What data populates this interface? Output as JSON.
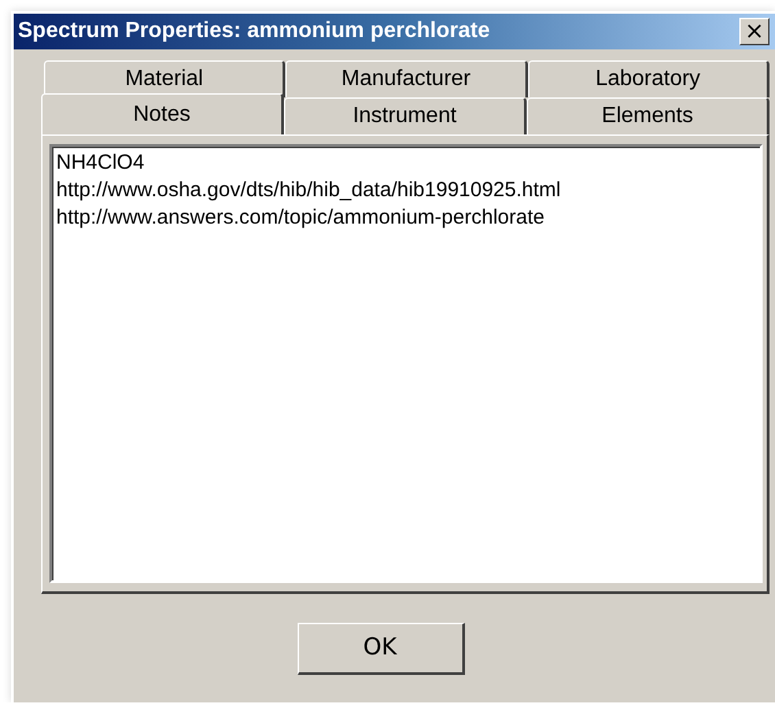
{
  "window": {
    "title": "Spectrum Properties:  ammonium perchlorate",
    "close": "×"
  },
  "tab_rows": [
    [
      {
        "label": "Material",
        "selected": false
      },
      {
        "label": "Manufacturer",
        "selected": false
      },
      {
        "label": "Laboratory",
        "selected": false
      }
    ],
    [
      {
        "label": "Notes",
        "selected": true
      },
      {
        "label": "Instrument",
        "selected": false
      },
      {
        "label": "Elements",
        "selected": false
      }
    ]
  ],
  "notes": {
    "lines": [
      "NH4ClO4",
      "http://www.osha.gov/dts/hib/hib_data/hib19910925.html",
      "http://www.answers.com/topic/ammonium-perchlorate"
    ]
  },
  "buttons": [
    "OK"
  ]
}
